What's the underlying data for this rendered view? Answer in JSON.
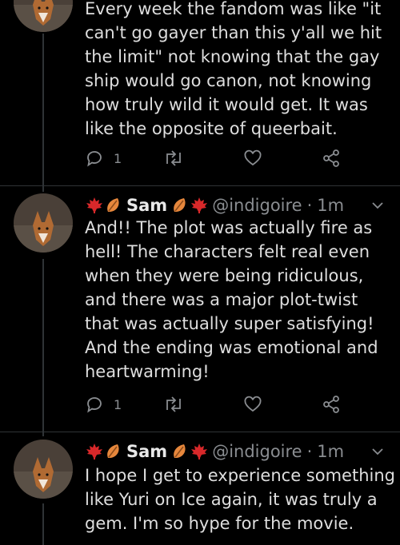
{
  "colors": {
    "background": "#000000",
    "text": "#dedede",
    "secondary": "#8a8d91",
    "divider": "#2f3336"
  },
  "tweets": [
    {
      "text": "Every week the fandom was like \"it can't go gayer than this y'all we hit the limit\" not knowing that the gay ship would go canon, not knowing how truly wild it would get. It was like the opposite of queerbait.",
      "reply_count": "1"
    },
    {
      "display_name": "Sam",
      "handle": "@indigoire",
      "separator": "·",
      "time": "1m",
      "name_emojis": [
        "maple-leaf",
        "fallen-leaf"
      ],
      "text": "And!! The plot was actually fire as hell! The characters felt real even when they were being ridiculous, and there was a major plot-twist that was actually super satisfying! And the ending was emotional and heartwarming!",
      "reply_count": "1"
    },
    {
      "display_name": "Sam",
      "handle": "@indigoire",
      "separator": "·",
      "time": "1m",
      "name_emojis": [
        "maple-leaf",
        "fallen-leaf"
      ],
      "text": "I hope I get to experience something like Yuri on Ice again, it was truly a gem. I'm so hype for the movie."
    }
  ]
}
